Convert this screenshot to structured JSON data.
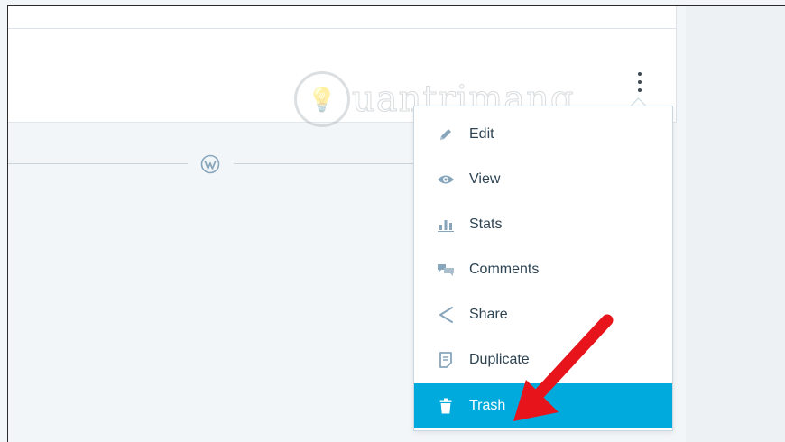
{
  "menu": {
    "items": [
      {
        "label": "Edit",
        "icon": "pencil-icon"
      },
      {
        "label": "View",
        "icon": "eye-icon"
      },
      {
        "label": "Stats",
        "icon": "bar-chart-icon"
      },
      {
        "label": "Comments",
        "icon": "comments-icon"
      },
      {
        "label": "Share",
        "icon": "share-icon"
      },
      {
        "label": "Duplicate",
        "icon": "document-icon"
      },
      {
        "label": "Trash",
        "icon": "trash-icon",
        "active": true
      }
    ]
  },
  "colors": {
    "accent": "#00aadc",
    "annotation_arrow": "#e8141b",
    "text": "#2e4453",
    "icon": "#87a6bc"
  },
  "watermark": {
    "text": "uantrimang"
  }
}
